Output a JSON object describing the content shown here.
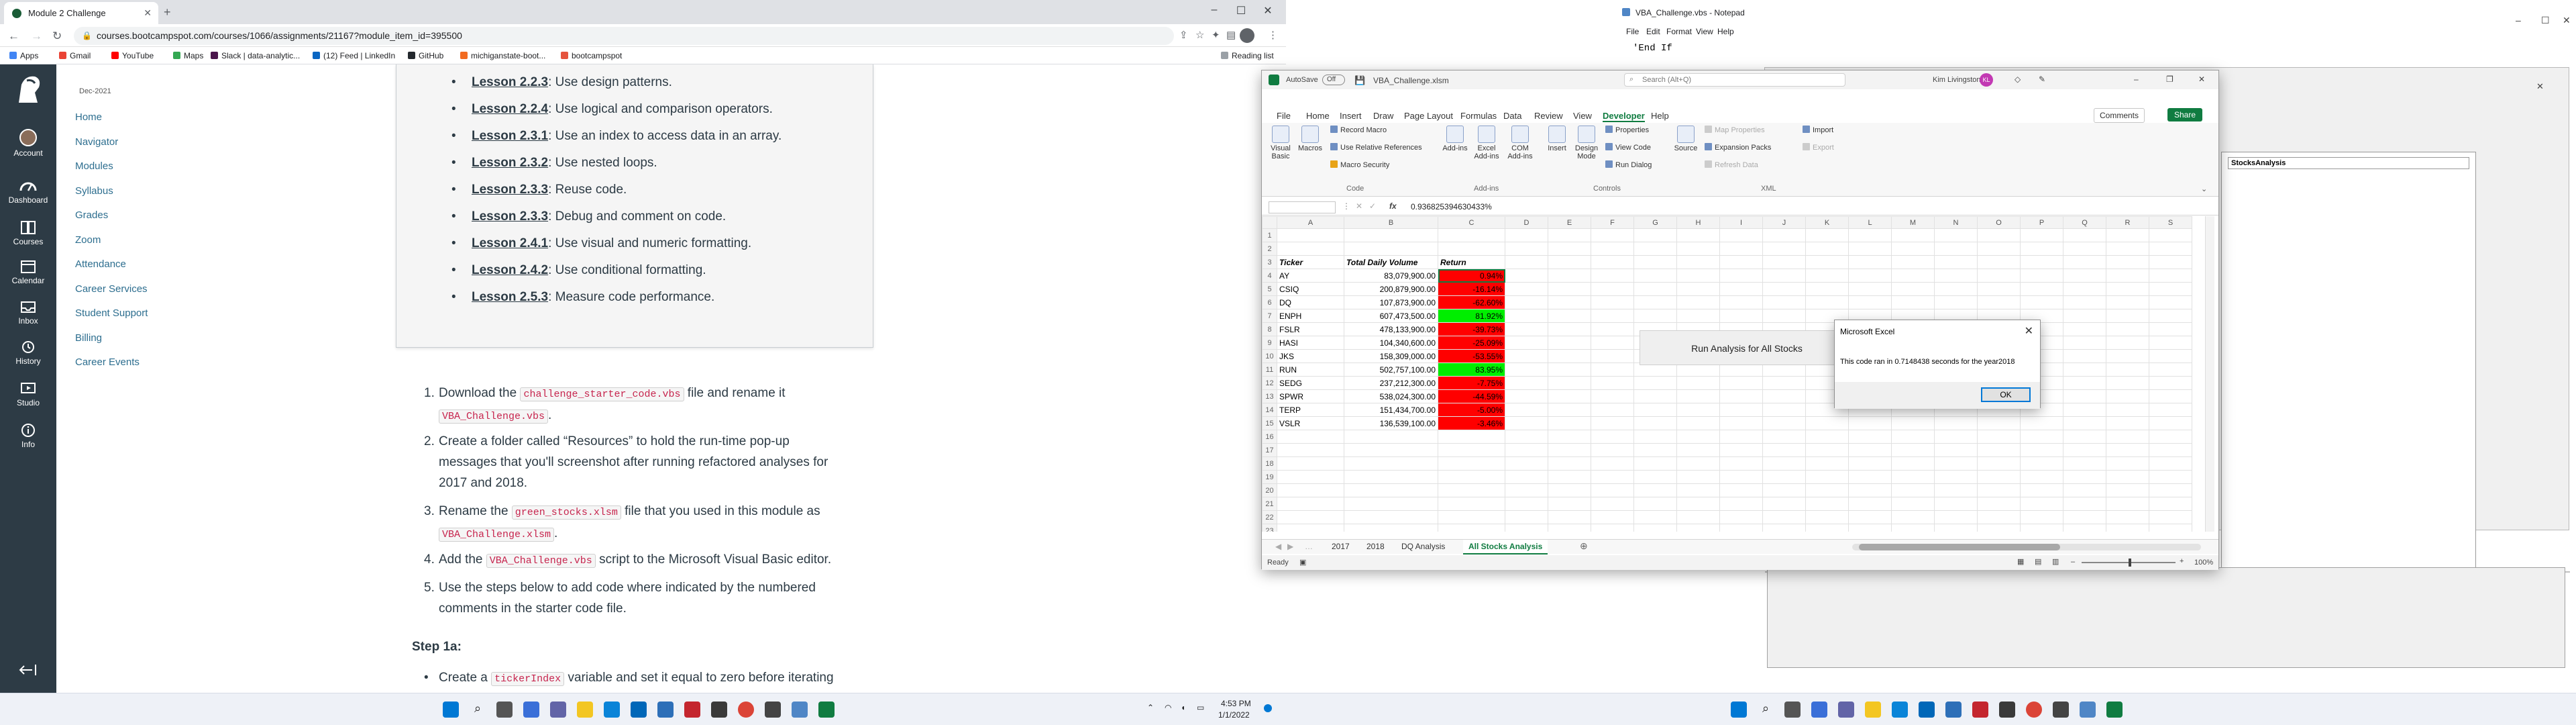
{
  "browser": {
    "tab_title": "Module 2 Challenge",
    "url": "courses.bootcampspot.com/courses/1066/assignments/21167?module_item_id=395500",
    "bookmarks": [
      "Apps",
      "Gmail",
      "YouTube",
      "Maps",
      "Slack | data-analytic...",
      "(12) Feed | LinkedIn",
      "GitHub",
      "michiganstate-boot...",
      "bootcampspot"
    ],
    "reading_list": "Reading list",
    "colors": {
      "tabbar": "#dfe1e5",
      "toolbar": "#ffffff"
    }
  },
  "canvas": {
    "global_nav": [
      {
        "label": "Account",
        "icon": "account-icon"
      },
      {
        "label": "Dashboard",
        "icon": "dashboard-icon"
      },
      {
        "label": "Courses",
        "icon": "courses-icon"
      },
      {
        "label": "Calendar",
        "icon": "calendar-icon"
      },
      {
        "label": "Inbox",
        "icon": "inbox-icon"
      },
      {
        "label": "History",
        "icon": "history-icon"
      },
      {
        "label": "Studio",
        "icon": "studio-icon"
      },
      {
        "label": "Info",
        "icon": "info-icon"
      }
    ],
    "course_date": "Dec-2021",
    "course_nav": [
      "Home",
      "Navigator",
      "Modules",
      "Syllabus",
      "Grades",
      "Zoom",
      "Attendance",
      "Career Services",
      "Student Support",
      "Billing",
      "Career Events"
    ],
    "lessons": [
      {
        "link": "Lesson 2.2.3",
        "text": ": Use design patterns."
      },
      {
        "link": "Lesson 2.2.4",
        "text": ": Use logical and comparison operators."
      },
      {
        "link": "Lesson 2.3.1",
        "text": ": Use an index to access data in an array."
      },
      {
        "link": "Lesson 2.3.2",
        "text": ": Use nested loops."
      },
      {
        "link": "Lesson 2.3.3",
        "text": ": Reuse code."
      },
      {
        "link": "Lesson 2.3.3",
        "text": ": Debug and comment on code."
      },
      {
        "link": "Lesson 2.4.1",
        "text": ": Use visual and numeric formatting."
      },
      {
        "link": "Lesson 2.4.2",
        "text": ": Use conditional formatting."
      },
      {
        "link": "Lesson 2.5.3",
        "text": ": Measure code performance."
      }
    ],
    "steps": {
      "s1_a": "Download the ",
      "s1_code1": "challenge_starter_code.vbs",
      "s1_b": " file and rename it",
      "s1_code2": "VBA_Challenge.vbs",
      "s1_c": ".",
      "s2_a": "Create a folder called “Resources” to hold the run-time pop-up",
      "s2_b": "messages that you'll screenshot after running refactored analyses for",
      "s2_c": "2017 and 2018.",
      "s3_a": "Rename the ",
      "s3_code1": "green_stocks.xlsm",
      "s3_b": " file that you used in this module as",
      "s3_code2": "VBA_Challenge.xlsm",
      "s3_c": ".",
      "s4_a": "Add the ",
      "s4_code": "VBA_Challenge.vbs",
      "s4_b": " script to the Microsoft Visual Basic editor.",
      "s5_a": "Use the steps below to add code where indicated by the numbered",
      "s5_b": "comments in the starter code file.",
      "step1a": "Step 1a:",
      "s6_a": "Create a ",
      "s6_code": "tickerIndex",
      "s6_b": " variable and set it equal to zero before iterating"
    }
  },
  "notepad": {
    "title": "VBA_Challenge.vbs - Notepad",
    "menu": [
      "File",
      "Edit",
      "Format",
      "View",
      "Help"
    ],
    "text": "'End If"
  },
  "vba_editor": {
    "module_label": "StocksAnalysis"
  },
  "excel": {
    "autosave": "AutoSave",
    "autosave_state": "Off",
    "file_name": "VBA_Challenge.xlsm",
    "search_placeholder": "Search (Alt+Q)",
    "user_name": "Kim Livingston",
    "user_initials": "KL",
    "menu": [
      "File",
      "Home",
      "Insert",
      "Draw",
      "Page Layout",
      "Formulas",
      "Data",
      "Review",
      "View",
      "Developer",
      "Help"
    ],
    "comments_label": "Comments",
    "share_label": "Share",
    "ribbon": {
      "visual_basic": "Visual Basic",
      "macros": "Macros",
      "record_macro": "Record Macro",
      "use_relative": "Use Relative References",
      "macro_security": "Macro Security",
      "code_group": "Code",
      "addins": "Add-ins",
      "excel_addins": "Excel Add-ins",
      "com_addins": "COM Add-ins",
      "addins_group": "Add-ins",
      "insert": "Insert",
      "design_mode": "Design Mode",
      "properties": "Properties",
      "view_code": "View Code",
      "run_dialog": "Run Dialog",
      "controls_group": "Controls",
      "source": "Source",
      "map_properties": "Map Properties",
      "expansion_packs": "Expansion Packs",
      "refresh_data": "Refresh Data",
      "import": "Import",
      "export": "Export",
      "xml_group": "XML"
    },
    "formula_value": "0.936825394630433%",
    "columns": [
      "A",
      "B",
      "C",
      "D",
      "E",
      "F",
      "G",
      "H",
      "I",
      "J",
      "K",
      "L",
      "M",
      "N",
      "O",
      "P",
      "Q",
      "R",
      "S"
    ],
    "headers": [
      "Ticker",
      "Total Daily Volume",
      "Return"
    ],
    "rows": [
      {
        "ticker": "AY",
        "volume": "83,079,900.00",
        "ret": "0.94%",
        "positive": false
      },
      {
        "ticker": "CSIQ",
        "volume": "200,879,900.00",
        "ret": "-16.14%",
        "positive": false
      },
      {
        "ticker": "DQ",
        "volume": "107,873,900.00",
        "ret": "-62.60%",
        "positive": false
      },
      {
        "ticker": "ENPH",
        "volume": "607,473,500.00",
        "ret": "81.92%",
        "positive": true
      },
      {
        "ticker": "FSLR",
        "volume": "478,133,900.00",
        "ret": "-39.73%",
        "positive": false
      },
      {
        "ticker": "HASI",
        "volume": "104,340,600.00",
        "ret": "-25.09%",
        "positive": false
      },
      {
        "ticker": "JKS",
        "volume": "158,309,000.00",
        "ret": "-53.55%",
        "positive": false
      },
      {
        "ticker": "RUN",
        "volume": "502,757,100.00",
        "ret": "83.95%",
        "positive": true
      },
      {
        "ticker": "SEDG",
        "volume": "237,212,300.00",
        "ret": "-7.75%",
        "positive": false
      },
      {
        "ticker": "SPWR",
        "volume": "538,024,300.00",
        "ret": "-44.59%",
        "positive": false
      },
      {
        "ticker": "TERP",
        "volume": "151,434,700.00",
        "ret": "-5.00%",
        "positive": false
      },
      {
        "ticker": "VSLR",
        "volume": "136,539,100.00",
        "ret": "-3.46%",
        "positive": false
      }
    ],
    "sheet_tabs": [
      "2017",
      "2018",
      "DQ Analysis",
      "All Stocks Analysis"
    ],
    "active_sheet": "All Stocks Analysis",
    "status": "Ready",
    "zoom": "100%",
    "colors": {
      "negative": "#ff0000",
      "positive": "#00ee00",
      "accent": "#107c41"
    }
  },
  "run_button": {
    "label": "Run  Analysis for All Stocks"
  },
  "msgbox": {
    "title": "Microsoft Excel",
    "message": "This code ran in 0.7148438 seconds for the year2018",
    "ok": "OK"
  },
  "taskbar": {
    "time": "4:53 PM",
    "date": "1/1/2022"
  }
}
